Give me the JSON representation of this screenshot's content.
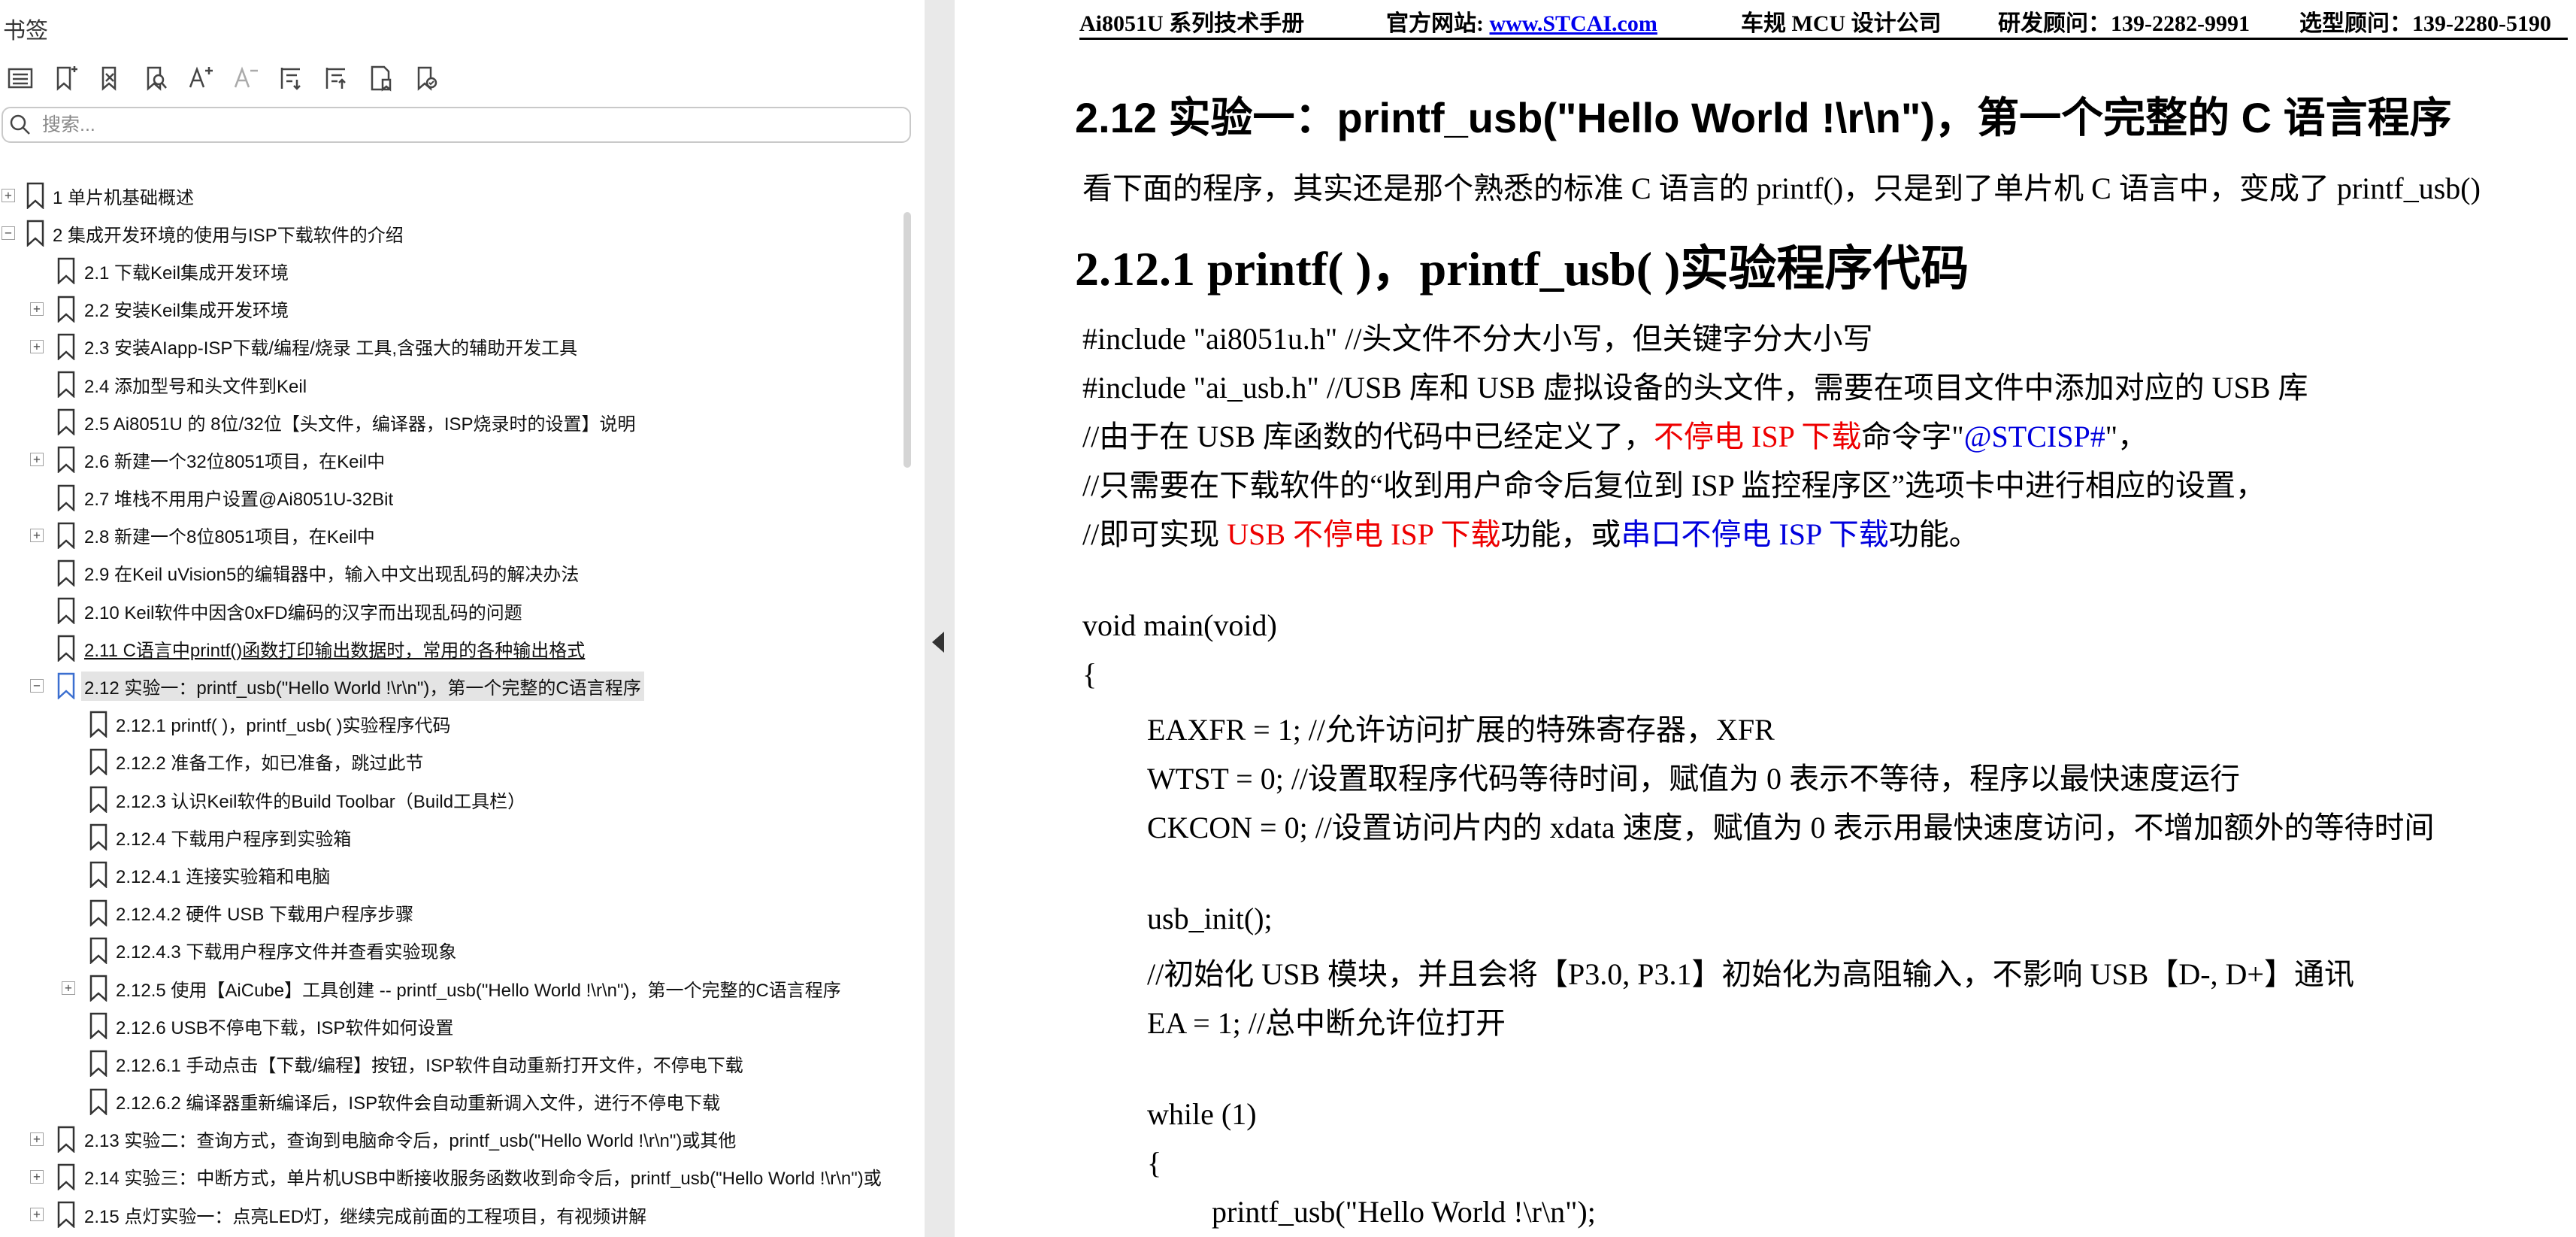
{
  "panel": {
    "title": "书签",
    "search_placeholder": "搜索...",
    "toolbar_icons": [
      "options-menu-icon",
      "new-bookmark-icon",
      "delete-bookmark-icon",
      "find-bookmark-icon",
      "expand-text-size-icon",
      "reduce-text-size-icon",
      "expand-all-icon",
      "collapse-all-icon",
      "bookmark-properties-icon",
      "tag-bookmark-icon"
    ]
  },
  "tree": [
    {
      "label": "1  单片机基础概述",
      "level": 0,
      "expander": "+"
    },
    {
      "label": "2  集成开发环境的使用与ISP下载软件的介绍",
      "level": 0,
      "expander": "−"
    },
    {
      "label": "2.1 下载Keil集成开发环境",
      "level": 1,
      "expander": ""
    },
    {
      "label": "2.2  安装Keil集成开发环境",
      "level": 1,
      "expander": "+"
    },
    {
      "label": "2.3  安装AIapp-ISP下载/编程/烧录 工具,含强大的辅助开发工具",
      "level": 1,
      "expander": "+"
    },
    {
      "label": "2.4  添加型号和头文件到Keil",
      "level": 1,
      "expander": ""
    },
    {
      "label": "2.5  Ai8051U 的 8位/32位【头文件，编译器，ISP烧录时的设置】说明",
      "level": 1,
      "expander": ""
    },
    {
      "label": "2.6 新建一个32位8051项目，在Keil中",
      "level": 1,
      "expander": "+"
    },
    {
      "label": "2.7  堆栈不用用户设置@Ai8051U-32Bit",
      "level": 1,
      "expander": ""
    },
    {
      "label": "2.8  新建一个8位8051项目，在Keil中",
      "level": 1,
      "expander": "+"
    },
    {
      "label": "2.9  在Keil uVision5的编辑器中，输入中文出现乱码的解决办法",
      "level": 1,
      "expander": ""
    },
    {
      "label": "2.10  Keil软件中因含0xFD编码的汉字而出现乱码的问题",
      "level": 1,
      "expander": ""
    },
    {
      "label": "2.11  C语言中printf()函数打印输出数据时，常用的各种输出格式",
      "level": 1,
      "expander": "",
      "underline": true
    },
    {
      "label": "2.12  实验一：printf_usb(\"Hello World !\\r\\n\")，第一个完整的C语言程序",
      "level": 1,
      "expander": "−",
      "selected": true
    },
    {
      "label": "2.12.1 printf( )，printf_usb( )实验程序代码",
      "level": 2,
      "expander": ""
    },
    {
      "label": "2.12.2 准备工作，如已准备，跳过此节",
      "level": 2,
      "expander": ""
    },
    {
      "label": "2.12.3  认识Keil软件的Build Toolbar（Build工具栏）",
      "level": 2,
      "expander": ""
    },
    {
      "label": "2.12.4 下载用户程序到实验箱",
      "level": 2,
      "expander": ""
    },
    {
      "label": "2.12.4.1 连接实验箱和电脑",
      "level": 2,
      "expander": ""
    },
    {
      "label": "2.12.4.2  硬件 USB 下载用户程序步骤",
      "level": 2,
      "expander": ""
    },
    {
      "label": "2.12.4.3  下载用户程序文件并查看实验现象",
      "level": 2,
      "expander": ""
    },
    {
      "label": "2.12.5  使用【AiCube】工具创建 -- printf_usb(\"Hello World !\\r\\n\")，第一个完整的C语言程序",
      "level": 2,
      "expander": "+"
    },
    {
      "label": "2.12.6  USB不停电下载，ISP软件如何设置",
      "level": 2,
      "expander": ""
    },
    {
      "label": "2.12.6.1 手动点击【下载/编程】按钮，ISP软件自动重新打开文件，不停电下载",
      "level": 2,
      "expander": ""
    },
    {
      "label": "2.12.6.2  编译器重新编译后，ISP软件会自动重新调入文件，进行不停电下载",
      "level": 2,
      "expander": ""
    },
    {
      "label": "2.13  实验二：查询方式，查询到电脑命令后，printf_usb(\"Hello World !\\r\\n\")或其他",
      "level": 1,
      "expander": "+"
    },
    {
      "label": "2.14  实验三：中断方式，单片机USB中断接收服务函数收到命令后，printf_usb(\"Hello World !\\r\\n\")或",
      "level": 1,
      "expander": "+"
    },
    {
      "label": "2.15  点灯实验一：点亮LED灯，继续完成前面的工程项目，有视频讲解",
      "level": 1,
      "expander": "+"
    }
  ],
  "doc": {
    "header": {
      "manual": "Ai8051U 系列技术手册",
      "site_label": "官方网站: ",
      "site_link": "www.STCAI.com",
      "company": "车规 MCU 设计公司",
      "rd_contact": "研发顾问：139-2282-9991",
      "sales_contact": "选型顾问：139-2280-5190"
    },
    "h2": "2.12    实验一：printf_usb(\"Hello World !\\r\\n\")，第一个完整的 C 语言程序",
    "intro": "看下面的程序，其实还是那个熟悉的标准 C 语言的 printf()，只是到了单片机 C 语言中，变成了 printf_usb()",
    "h3": "2.12.1      printf( )，printf_usb( )实验程序代码",
    "code": {
      "l1": "#include    \"ai8051u.h\"   //头文件不分大小写，但关键字分大小写",
      "l2": "#include    \"ai_usb.h\"     //USB 库和 USB 虚拟设备的头文件，需要在项目文件中添加对应的 USB 库",
      "l3a": "//由于在 USB 库函数的代码中已经定义了，",
      "l3b": "不停电 ISP 下载",
      "l3c": "命令字\"",
      "l3d": "@STCISP#",
      "l3e": "\"，",
      "l4": "//只需要在下载软件的“收到用户命令后复位到 ISP 监控程序区”选项卡中进行相应的设置，",
      "l5a": "//即可实现 ",
      "l5b": "USB 不停电 ISP 下载",
      "l5c": "功能，或",
      "l5d": "串口不停电 ISP 下载",
      "l5e": "功能。",
      "l6": "void    main(void)",
      "l7": "{",
      "l8": "EAXFR = 1;   //允许访问扩展的特殊寄存器，XFR",
      "l9": "WTST = 0;     //设置取程序代码等待时间，赋值为  0  表示不等待，程序以最快速度运行",
      "l10": "CKCON = 0;  //设置访问片内的  xdata  速度，赋值为  0  表示用最快速度访问，不增加额外的等待时间",
      "l11": "usb_init();",
      "l12": "//初始化 USB 模块，并且会将【P3.0, P3.1】初始化为高阻输入，不影响 USB【D-, D+】通讯",
      "l13": "EA = 1;            //总中断允许位打开",
      "l14": "while (1)",
      "l15": "{",
      "l16": "printf_usb(\"Hello World !\\r\\n\");"
    }
  }
}
